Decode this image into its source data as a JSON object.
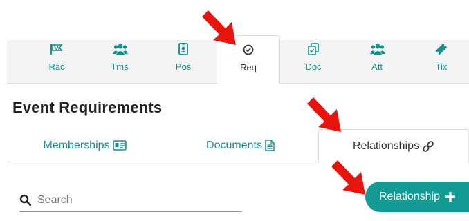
{
  "nav": {
    "items": [
      {
        "label": "Rac",
        "icon": "flag-icon"
      },
      {
        "label": "Tms",
        "icon": "users-icon"
      },
      {
        "label": "Pos",
        "icon": "id-badge-icon"
      },
      {
        "label": "Req",
        "icon": "check-circle-icon",
        "active": true
      },
      {
        "label": "Doc",
        "icon": "documents-icon"
      },
      {
        "label": "Att",
        "icon": "users-icon"
      },
      {
        "label": "Tix",
        "icon": "ticket-icon"
      }
    ]
  },
  "page": {
    "title": "Event Requirements"
  },
  "subtabs": [
    {
      "label": "Memberships",
      "icon": "id-card-icon"
    },
    {
      "label": "Documents",
      "icon": "file-text-icon"
    },
    {
      "label": "Relationships",
      "icon": "link-icon",
      "active": true
    }
  ],
  "search": {
    "placeholder": "Search",
    "icon": "search-icon"
  },
  "add_button": {
    "label": "Relationship",
    "icon": "plus-icon"
  },
  "colors": {
    "accent": "#149a94",
    "link": "#1a8f8a",
    "annotation_arrow": "#e8150f"
  }
}
